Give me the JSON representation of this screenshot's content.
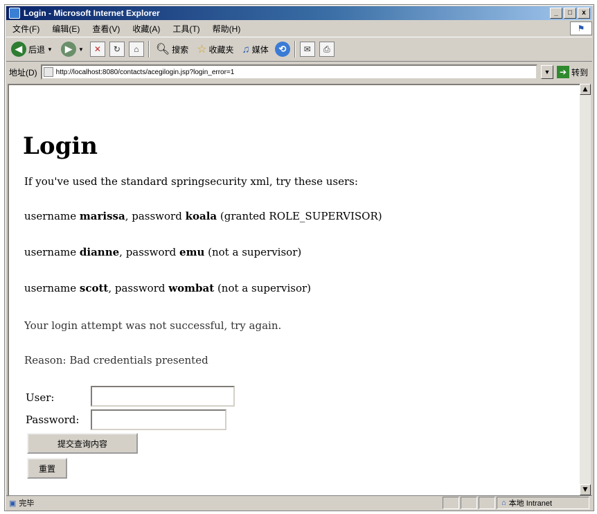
{
  "window": {
    "title": "Login - Microsoft Internet Explorer",
    "controls": [
      "_",
      "□",
      "x"
    ]
  },
  "menu": {
    "items": [
      "文件(F)",
      "编辑(E)",
      "查看(V)",
      "收藏(A)",
      "工具(T)",
      "帮助(H)"
    ]
  },
  "toolbar": {
    "back_label": "后退",
    "search_label": "搜索",
    "favorites_label": "收藏夹",
    "media_label": "媒体"
  },
  "address": {
    "label": "地址(D)",
    "url": "http://localhost:8080/contacts/acegilogin.jsp?login_error=1",
    "go_label": "转到"
  },
  "page": {
    "heading": "Login",
    "intro": "If you've used the standard springsecurity xml, try these users:",
    "users": [
      {
        "prefix": "username ",
        "name": "marissa",
        "mid": ", password ",
        "pw": "koala",
        "suffix": " (granted ROLE_SUPERVISOR)"
      },
      {
        "prefix": "username ",
        "name": "dianne",
        "mid": ", password ",
        "pw": "emu",
        "suffix": " (not a supervisor)"
      },
      {
        "prefix": "username ",
        "name": "scott",
        "mid": ", password ",
        "pw": "wombat",
        "suffix": " (not a supervisor)"
      }
    ],
    "error_message": "Your login attempt was not successful, try again.",
    "reason": "Reason: Bad credentials presented",
    "form": {
      "user_label": "User:",
      "user_value": "",
      "password_label": "Password:",
      "password_value": "",
      "submit_label": "提交查询内容",
      "reset_label": "重置"
    }
  },
  "status": {
    "left_text": "完毕",
    "zone_text": "本地 Intranet"
  }
}
